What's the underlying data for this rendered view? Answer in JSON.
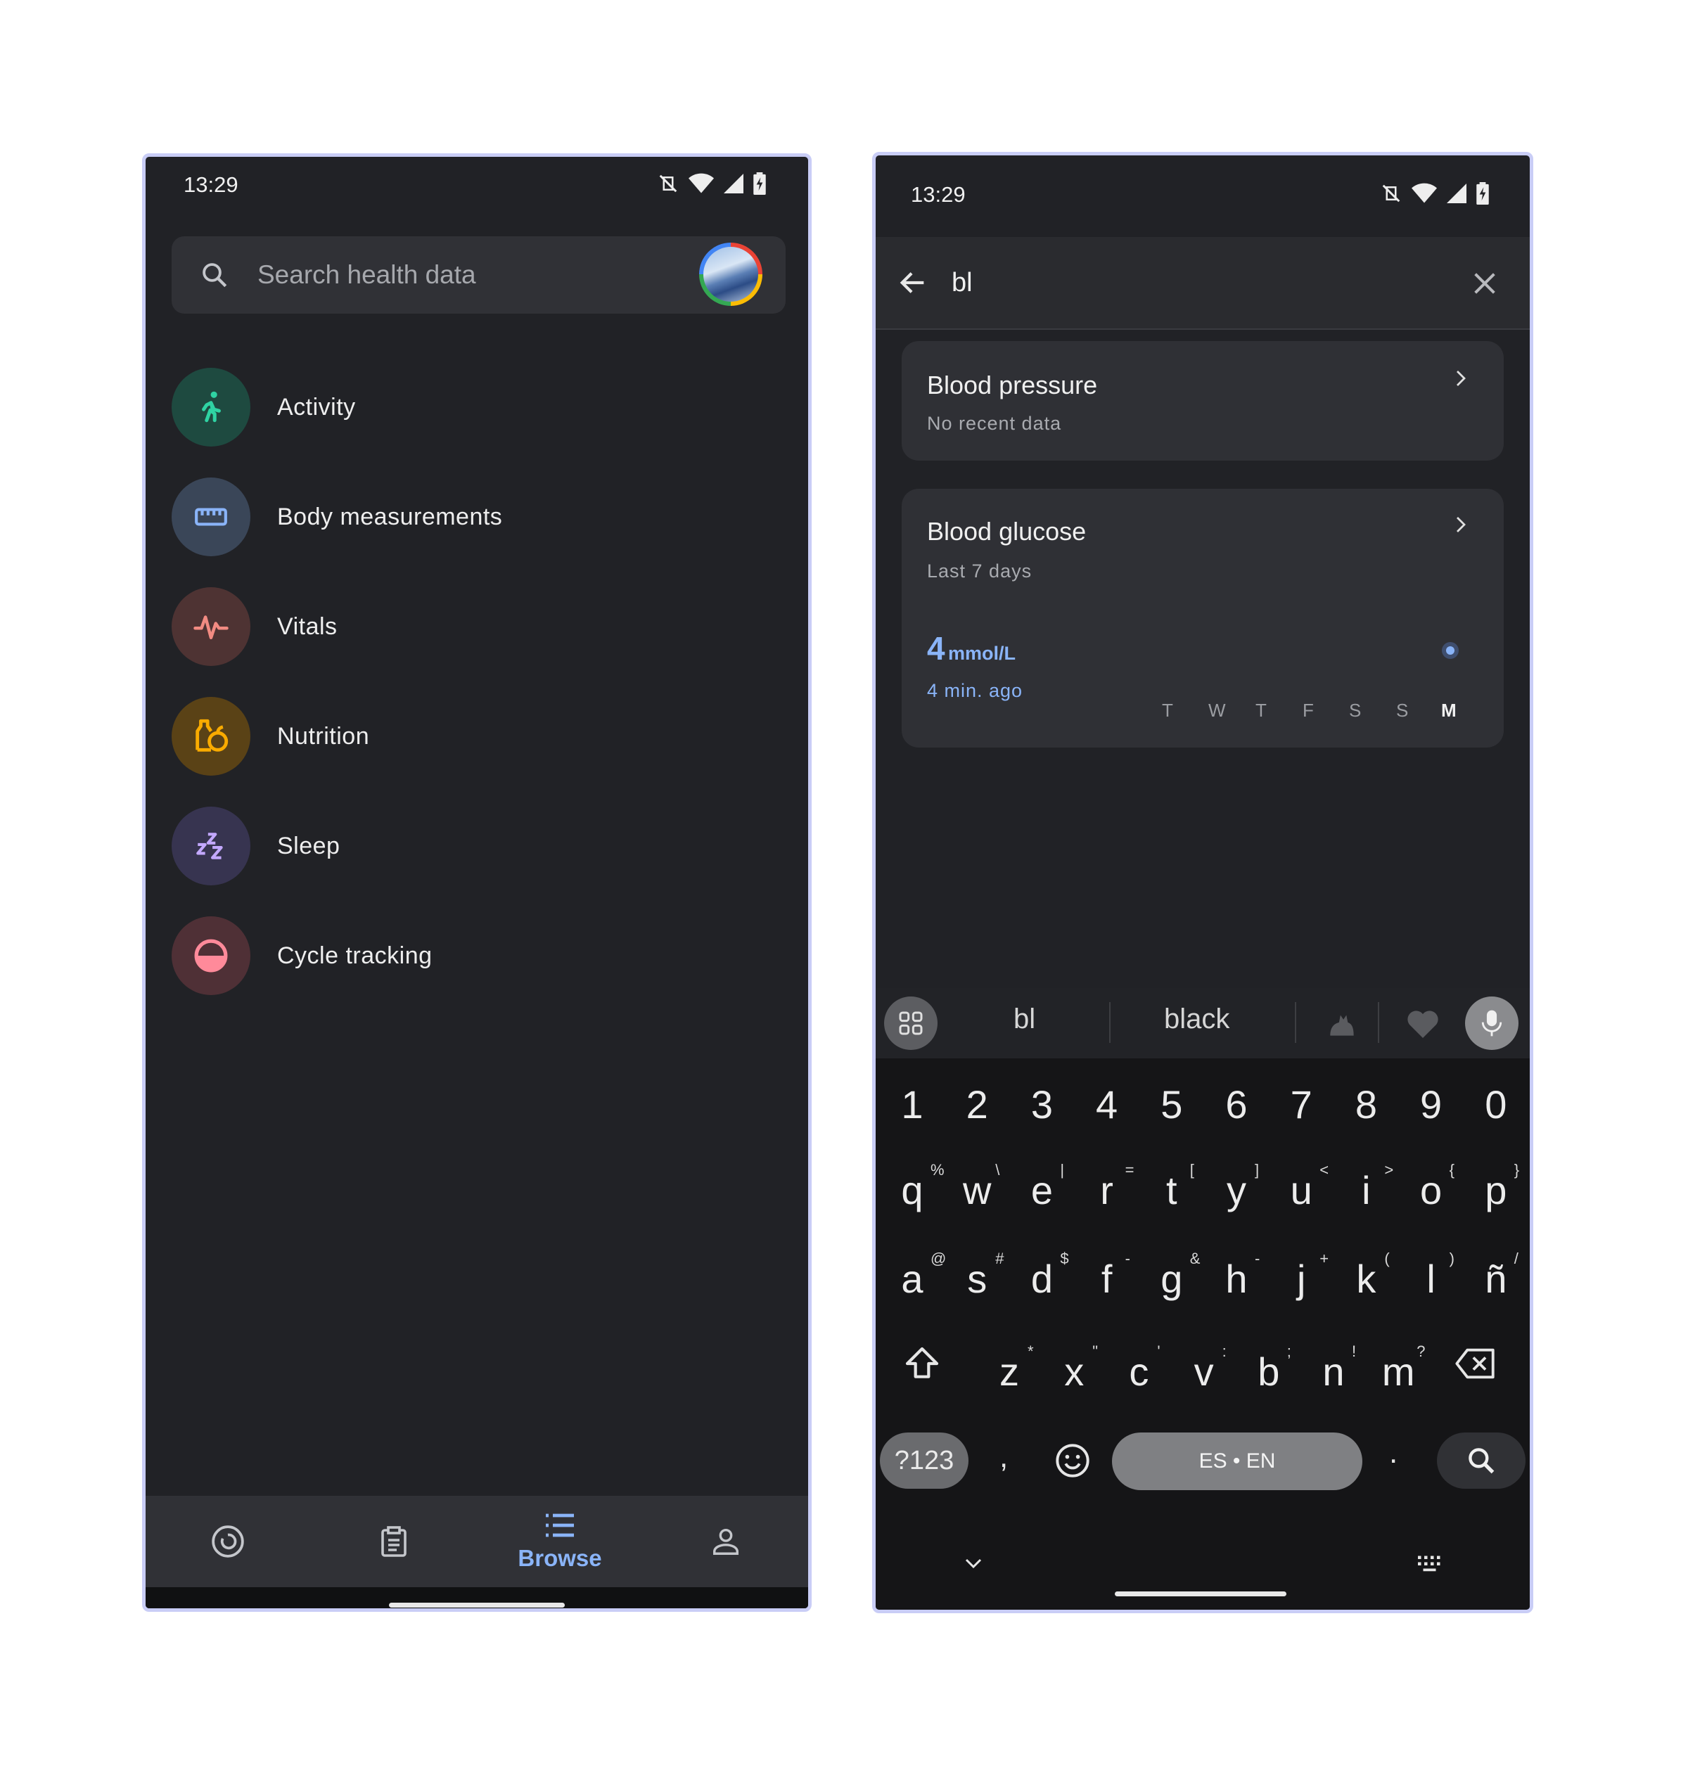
{
  "left_screen": {
    "status_time": "13:29",
    "search_placeholder": "Search health data",
    "categories": [
      {
        "label": "Activity",
        "icon": "running-icon",
        "color": "#2fd3a3"
      },
      {
        "label": "Body measurements",
        "icon": "ruler-icon",
        "color": "#8ab4f8"
      },
      {
        "label": "Vitals",
        "icon": "heartbeat-icon",
        "color": "#f28b82"
      },
      {
        "label": "Nutrition",
        "icon": "apple-bottle-icon",
        "color": "#f9ab00"
      },
      {
        "label": "Sleep",
        "icon": "zzz-icon",
        "color": "#c3a8ff"
      },
      {
        "label": "Cycle tracking",
        "icon": "half-circle-icon",
        "color": "#ff8a9a"
      }
    ],
    "bottom_nav": {
      "items": [
        {
          "icon": "home-ring-icon"
        },
        {
          "icon": "clipboard-icon"
        },
        {
          "icon": "list-icon",
          "label": "Browse",
          "active": true
        },
        {
          "icon": "person-icon"
        }
      ]
    }
  },
  "right_screen": {
    "status_time": "13:29",
    "query": "bl",
    "results": [
      {
        "title": "Blood pressure",
        "subtitle": "No recent data"
      },
      {
        "title": "Blood glucose",
        "subtitle": "Last 7 days",
        "value": "4",
        "unit": "mmol/L",
        "time": "4 min. ago",
        "days": [
          "T",
          "W",
          "T",
          "F",
          "S",
          "S",
          "M"
        ],
        "active_day": "M"
      }
    ],
    "keyboard": {
      "suggestions": [
        "bl",
        "black"
      ],
      "number_row": [
        "1",
        "2",
        "3",
        "4",
        "5",
        "6",
        "7",
        "8",
        "9",
        "0"
      ],
      "row1": [
        "q",
        "w",
        "e",
        "r",
        "t",
        "y",
        "u",
        "i",
        "o",
        "p"
      ],
      "row1_hints": [
        "%",
        "\\",
        "|",
        "=",
        "[",
        "]",
        "<",
        ">",
        "{",
        "}"
      ],
      "row2": [
        "a",
        "s",
        "d",
        "f",
        "g",
        "h",
        "j",
        "k",
        "l",
        "ñ"
      ],
      "row2_hints": [
        "@",
        "#",
        "$",
        "-",
        "&",
        "-",
        "+",
        "(",
        ")",
        "/"
      ],
      "row3": [
        "z",
        "x",
        "c",
        "v",
        "b",
        "n",
        "m"
      ],
      "row3_hints": [
        "*",
        "\"",
        "'",
        ":",
        ";",
        "!",
        "?"
      ],
      "symbols_key": "?123",
      "comma_key": ",",
      "period_key": ".",
      "space_label": "ES • EN"
    }
  },
  "colors": {
    "accent": "#8ab4f8",
    "background": "#212226",
    "surface": "#303136"
  }
}
